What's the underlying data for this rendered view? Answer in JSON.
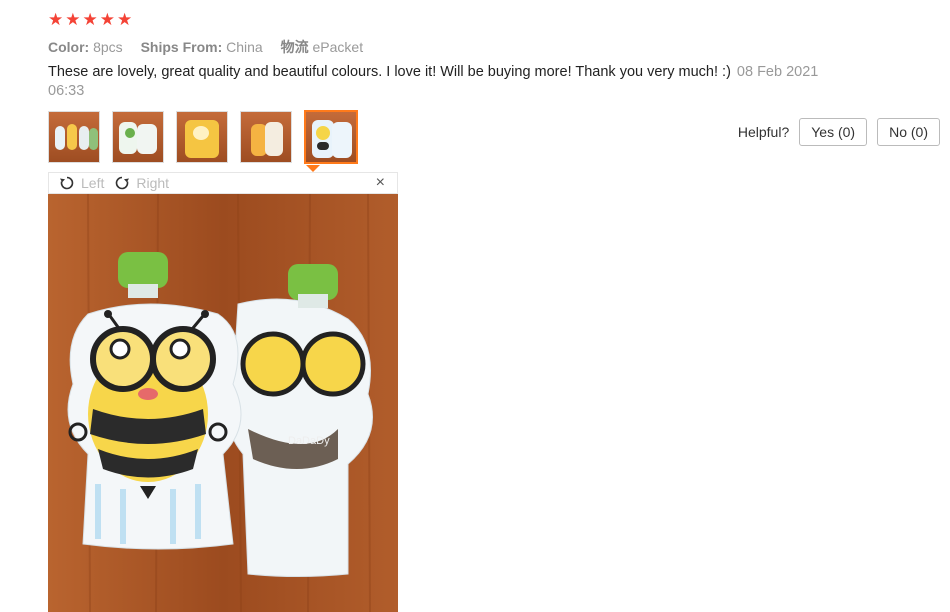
{
  "review": {
    "rating": 5,
    "stars": [
      "★",
      "★",
      "★",
      "★",
      "★"
    ],
    "color_label": "Color:",
    "color_value": "8pcs",
    "ships_label": "Ships From:",
    "ships_value": "China",
    "logistics_label": "物流",
    "logistics_value": "ePacket",
    "text": "These are lovely, great quality and beautiful colours. I love it! Will be buying more! Thank you very much! :)",
    "date": "08 Feb 2021 06:33",
    "thumbnails": [
      {
        "icon": "photo-thumbnail",
        "active": false
      },
      {
        "icon": "photo-thumbnail",
        "active": false
      },
      {
        "icon": "photo-thumbnail",
        "active": false
      },
      {
        "icon": "photo-thumbnail",
        "active": false
      },
      {
        "icon": "photo-thumbnail",
        "active": true
      }
    ]
  },
  "helpful": {
    "label": "Helpful?",
    "yes_label": "Yes (0)",
    "no_label": "No (0)"
  },
  "viewer": {
    "rotate_left_label": "Left",
    "rotate_right_label": "Right",
    "close_glyph": "×",
    "pouch_label": "DaDaDy"
  },
  "colors": {
    "star": "#f44336",
    "accent": "#ff7a1a",
    "wood": "#a9582a"
  }
}
